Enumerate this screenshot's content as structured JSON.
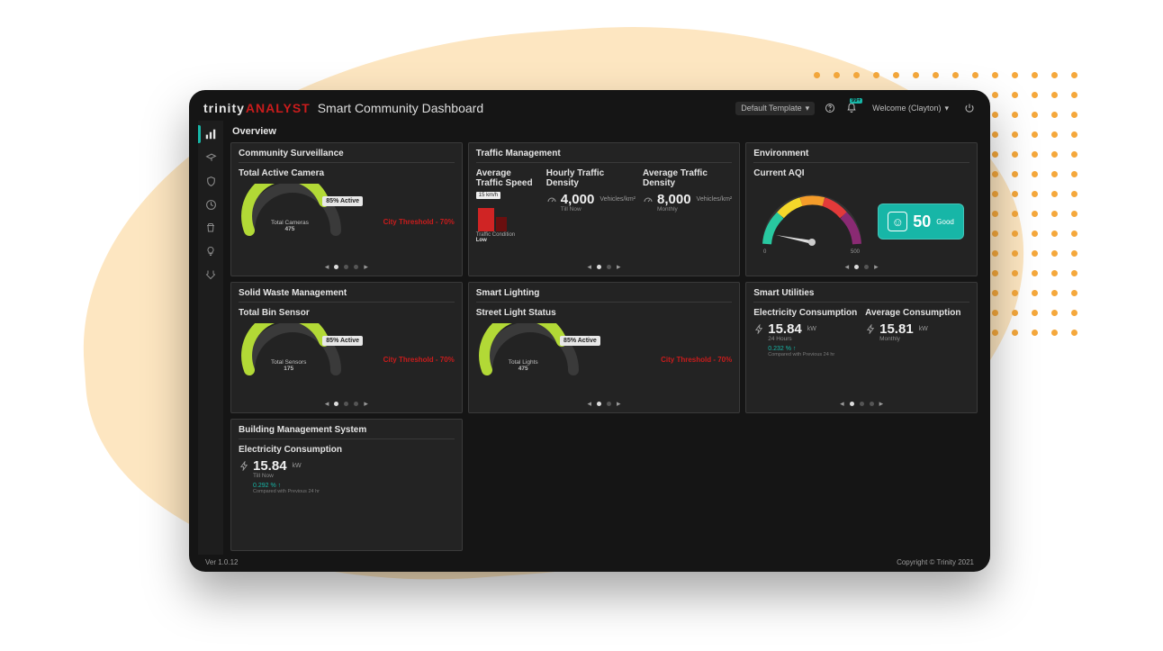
{
  "brand": {
    "t": "trinity",
    "a": "ANALYST",
    "subtitle": "Smart Community Dashboard"
  },
  "header": {
    "template_label": "Default Template",
    "bell_badge": "99+",
    "welcome": "Welcome (Clayton)"
  },
  "page_title": "Overview",
  "footer": {
    "version": "Ver 1.0.12",
    "copyright": "Copyright © Trinity 2021"
  },
  "cards": {
    "surveillance": {
      "title": "Community Surveillance",
      "metric": "Total Active Camera",
      "gauge_label_line1": "Total Cameras",
      "gauge_label_line2": "475",
      "badge": "85% Active",
      "threshold": "City Threshold - 70%"
    },
    "traffic": {
      "title": "Traffic Management",
      "col1": {
        "title": "Average Traffic Speed",
        "tag": "15 km/h",
        "cond_label": "Traffic Condition",
        "cond_value": "Low"
      },
      "col2": {
        "title": "Hourly Traffic Density",
        "value": "4,000",
        "unit": "Vehicles/km²",
        "note": "Till Now"
      },
      "col3": {
        "title": "Average Traffic Density",
        "value": "8,000",
        "unit": "Vehicles/km²",
        "note": "Monthly"
      }
    },
    "environment": {
      "title": "Environment",
      "metric": "Current AQI",
      "aqi_value": "50",
      "aqi_label": "Good",
      "scale_min": "0",
      "scale_max": "500"
    },
    "waste": {
      "title": "Solid Waste Management",
      "metric": "Total Bin Sensor",
      "gauge_label_line1": "Total Sensors",
      "gauge_label_line2": "175",
      "badge": "85% Active",
      "threshold": "City Threshold - 70%"
    },
    "lighting": {
      "title": "Smart Lighting",
      "metric": "Street Light Status",
      "gauge_label_line1": "Total Lights",
      "gauge_label_line2": "475",
      "badge": "85% Active",
      "threshold": "City Threshold - 70%"
    },
    "utilities": {
      "title": "Smart Utilities",
      "col1": {
        "title": "Electricity Consumption",
        "value": "15.84",
        "unit": "kW",
        "note": "24 Hours",
        "delta": "0.232 % ↑",
        "delta_note": "Compared with Previous 24 hr"
      },
      "col2": {
        "title": "Average Consumption",
        "value": "15.81",
        "unit": "kW",
        "note": "Monthly"
      }
    },
    "bms": {
      "title": "Building Management System",
      "metric": "Electricity Consumption",
      "value": "15.84",
      "unit": "kW",
      "note": "Till Now",
      "delta": "0.292 % ↑",
      "delta_note": "Compared with Previous 24 hr"
    }
  }
}
